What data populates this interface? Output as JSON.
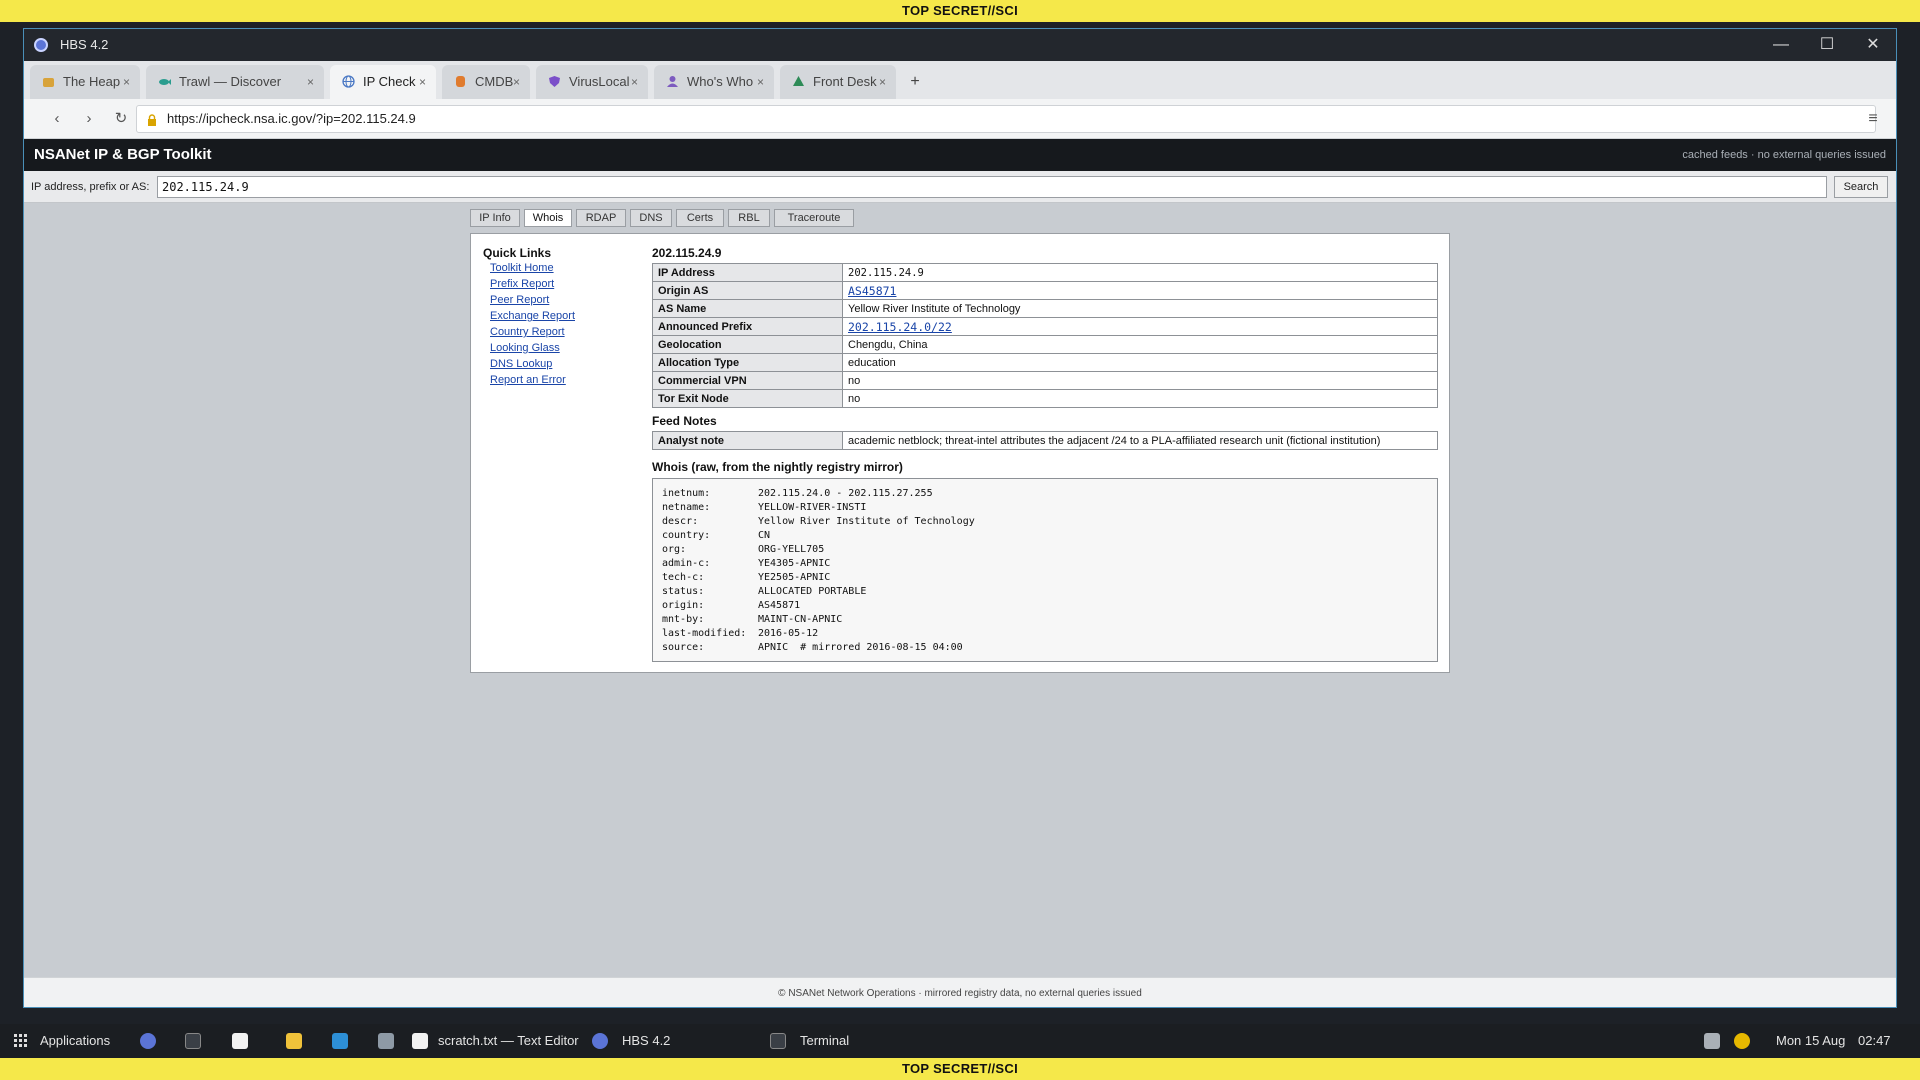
{
  "banner": {
    "classification": "TOP SECRET//SCI"
  },
  "window": {
    "title": "HBS 4.2",
    "minimize": "—",
    "maximize": "☐",
    "close": "✕"
  },
  "tabs": [
    {
      "label": "The Heap",
      "icon": "heap-icon",
      "active": false,
      "close": "×"
    },
    {
      "label": "Trawl — Discover",
      "icon": "trawl-fish-icon",
      "active": false,
      "close": "×"
    },
    {
      "label": "IP Check",
      "icon": "globe-icon",
      "active": true,
      "close": "×"
    },
    {
      "label": "CMDB",
      "icon": "database-icon",
      "active": false,
      "close": "×"
    },
    {
      "label": "VirusLocal",
      "icon": "shield-icon",
      "active": false,
      "close": "×"
    },
    {
      "label": "Who's Who",
      "icon": "person-icon",
      "active": false,
      "close": "×"
    },
    {
      "label": "Front Desk",
      "icon": "desk-icon",
      "active": false,
      "close": "×"
    }
  ],
  "newtab": "+",
  "nav": {
    "back": "‹",
    "forward": "›",
    "reload": "↻",
    "url": "https://ipcheck.nsa.ic.gov/?ip=202.115.24.9",
    "menu": "≡"
  },
  "app": {
    "title": "NSANet IP & BGP Toolkit",
    "note": "cached feeds · no external queries issued"
  },
  "search": {
    "label": "IP address, prefix or AS:",
    "value": "202.115.24.9",
    "button": "Search"
  },
  "subtabs": [
    "IP Info",
    "Whois",
    "RDAP",
    "DNS",
    "Certs",
    "RBL",
    "Traceroute"
  ],
  "active_subtab": "Whois",
  "quick_links": {
    "title": "Quick Links",
    "items": [
      "Toolkit Home",
      "Prefix Report",
      "Peer Report",
      "Exchange Report",
      "Country Report",
      "Looking Glass",
      "DNS Lookup",
      "Report an Error"
    ]
  },
  "result": {
    "title": "202.115.24.9",
    "rows": [
      {
        "key": "IP Address",
        "value": "202.115.24.9"
      },
      {
        "key": "Origin AS",
        "value": "AS45871"
      },
      {
        "key": "AS Name",
        "value": "Yellow River Institute of Technology"
      },
      {
        "key": "Announced Prefix",
        "value": "202.115.24.0/22"
      },
      {
        "key": "Geolocation",
        "value": "Chengdu, China"
      },
      {
        "key": "Allocation Type",
        "value": "education"
      },
      {
        "key": "Commercial VPN",
        "value": "no"
      },
      {
        "key": "Tor Exit Node",
        "value": "no"
      }
    ]
  },
  "feed_notes": {
    "title": "Feed Notes",
    "key": "Analyst note",
    "value": "academic netblock; threat-intel attributes the adjacent /24 to a PLA-affiliated research unit (fictional institution)"
  },
  "whois": {
    "title": "Whois (raw, from the nightly registry mirror)",
    "lines": [
      {
        "k": "inetnum:",
        "v": "202.115.24.0 - 202.115.27.255"
      },
      {
        "k": "netname:",
        "v": "YELLOW-RIVER-INSTI"
      },
      {
        "k": "descr:",
        "v": "Yellow River Institute of Technology"
      },
      {
        "k": "country:",
        "v": "CN"
      },
      {
        "k": "org:",
        "v": "ORG-YELL705"
      },
      {
        "k": "admin-c:",
        "v": "YE4305-APNIC"
      },
      {
        "k": "tech-c:",
        "v": "YE2505-APNIC"
      },
      {
        "k": "status:",
        "v": "ALLOCATED PORTABLE"
      },
      {
        "k": "origin:",
        "v": "AS45871"
      },
      {
        "k": "mnt-by:",
        "v": "MAINT-CN-APNIC"
      },
      {
        "k": "last-modified:",
        "v": "2016-05-12"
      },
      {
        "k": "source:",
        "v": "APNIC  # mirrored 2016-08-15 04:00"
      }
    ]
  },
  "footer": "© NSANet Network Operations · mirrored registry data, no external queries issued",
  "taskbar": {
    "apps_label": "Applications",
    "editor": "scratch.txt — Text Editor",
    "browser": "HBS 4.2",
    "terminal": "Terminal",
    "date": "Mon 15 Aug",
    "time": "02:47"
  },
  "colors": {
    "banner": "#f5e84a",
    "link": "#1a45a8",
    "apphead": "#16191d"
  }
}
